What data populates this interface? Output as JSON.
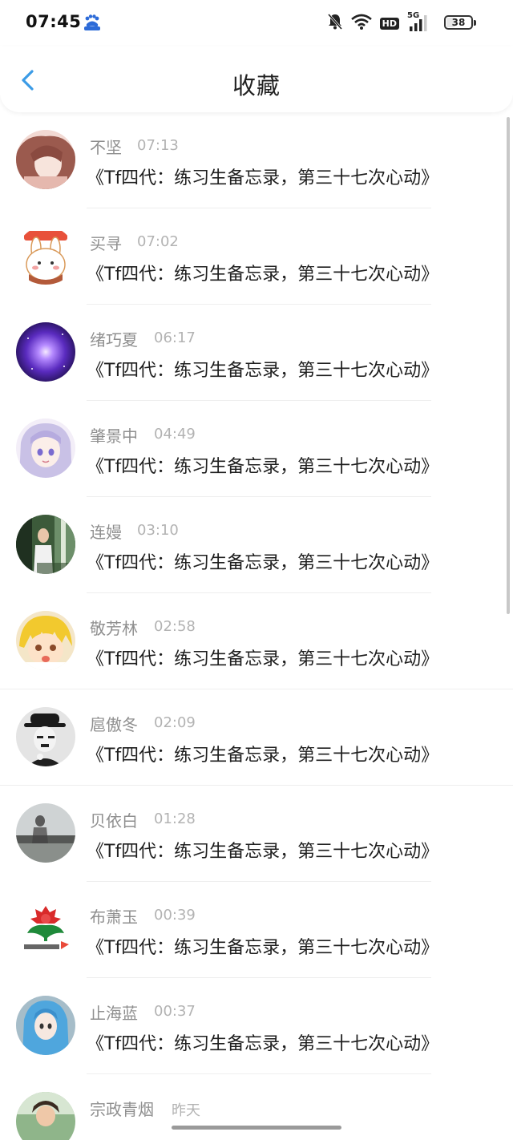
{
  "status_bar": {
    "time": "07:45",
    "network": "5G",
    "hd_label": "HD",
    "battery": "38",
    "battery_level": 0.38
  },
  "header": {
    "title": "收藏"
  },
  "items": [
    {
      "name": "不坚",
      "time": "07:13",
      "title": "《Tf四代：练习生备忘录，第三十七次心动》"
    },
    {
      "name": "买寻",
      "time": "07:02",
      "title": "《Tf四代：练习生备忘录，第三十七次心动》"
    },
    {
      "name": "绪巧夏",
      "time": "06:17",
      "title": "《Tf四代：练习生备忘录，第三十七次心动》"
    },
    {
      "name": "肇景中",
      "time": "04:49",
      "title": "《Tf四代：练习生备忘录，第三十七次心动》"
    },
    {
      "name": "连嫚",
      "time": "03:10",
      "title": "《Tf四代：练习生备忘录，第三十七次心动》"
    },
    {
      "name": "敬芳林",
      "time": "02:58",
      "title": "《Tf四代：练习生备忘录，第三十七次心动》"
    },
    {
      "name": "扈傲冬",
      "time": "02:09",
      "title": "《Tf四代：练习生备忘录，第三十七次心动》"
    },
    {
      "name": "贝依白",
      "time": "01:28",
      "title": "《Tf四代：练习生备忘录，第三十七次心动》"
    },
    {
      "name": "布萧玉",
      "time": "00:39",
      "title": "《Tf四代：练习生备忘录，第三十七次心动》"
    },
    {
      "name": "止海蓝",
      "time": "00:37",
      "title": "《Tf四代：练习生备忘录，第三十七次心动》"
    },
    {
      "name": "宗政青烟",
      "time": "昨天",
      "title": ""
    }
  ],
  "colors": {
    "accent": "#3b9be6",
    "name_text": "#8f8f8f",
    "time_text": "#b3b3b3",
    "title_text": "#1e1e1e"
  }
}
